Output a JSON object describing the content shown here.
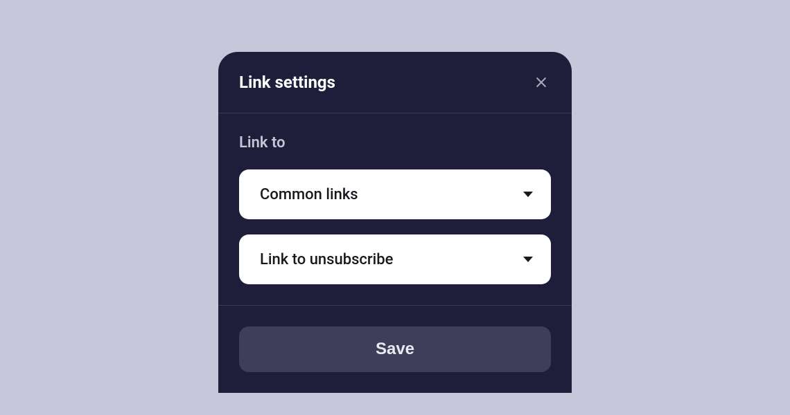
{
  "modal": {
    "title": "Link settings",
    "body_label": "Link to",
    "select1": "Common links",
    "select2": "Link to unsubscribe",
    "save_label": "Save"
  }
}
